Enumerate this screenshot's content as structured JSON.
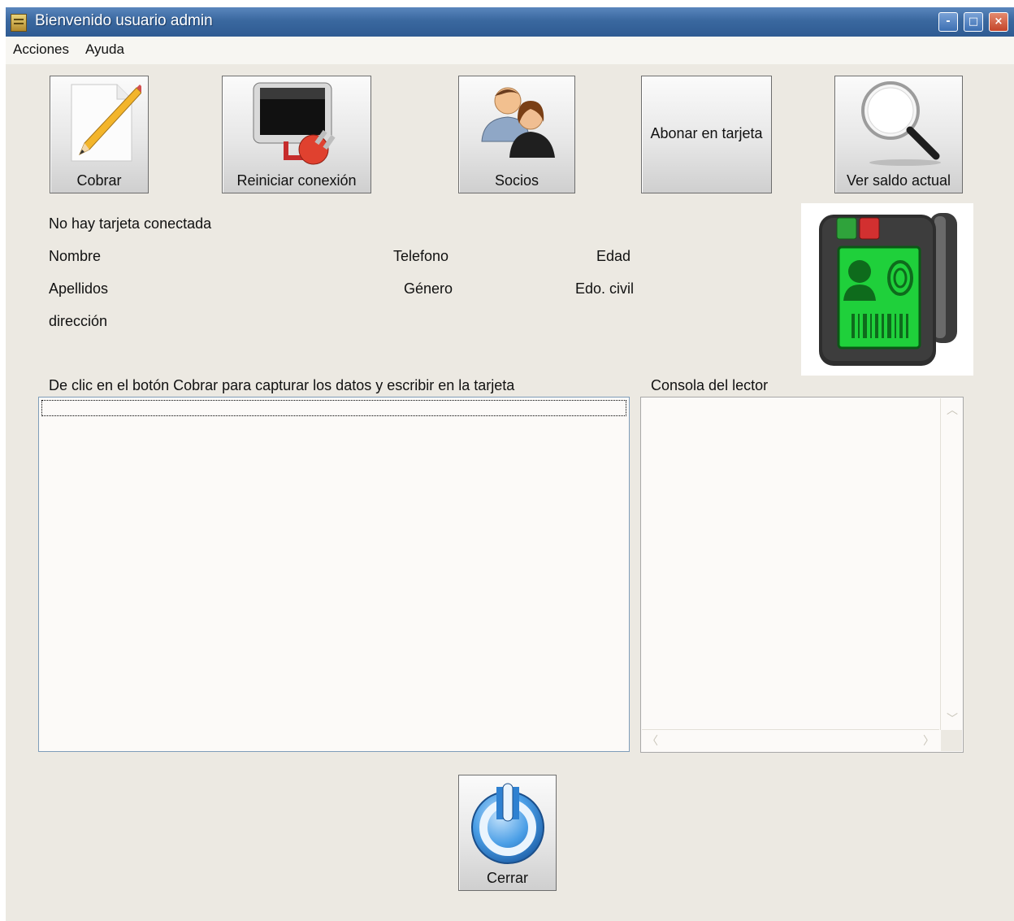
{
  "window": {
    "title": "Bienvenido usuario admin",
    "controls": {
      "minimize": "-",
      "maximize": "□",
      "close": "×"
    }
  },
  "menu": {
    "items": [
      "Acciones",
      "Ayuda"
    ]
  },
  "toolbar": {
    "cobrar_label": "Cobrar",
    "reiniciar_label": "Reiniciar conexión",
    "socios_label": "Socios",
    "abonar_label": "Abonar en tarjeta",
    "ver_saldo_label": "Ver saldo actual"
  },
  "card": {
    "status": "No hay tarjeta conectada",
    "nombre": "Nombre",
    "telefono": "Telefono",
    "edad": "Edad",
    "apellidos": "Apellidos",
    "genero": "Género",
    "edo_civil": "Edo. civil",
    "direccion": "dirección"
  },
  "instructions": "De clic en el botón Cobrar para capturar los datos y escribir en la tarjeta",
  "console_label": "Consola del lector",
  "close_button": "Cerrar",
  "icons": {
    "cobrar": "pencil-paper-icon",
    "reiniciar": "monitor-plug-icon",
    "socios": "users-icon",
    "ver_saldo": "magnifier-icon",
    "reader": "card-reader-icon",
    "cerrar": "power-icon"
  }
}
